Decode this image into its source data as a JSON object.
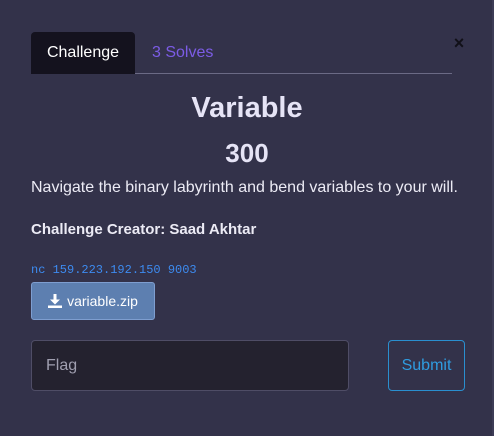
{
  "tabs": {
    "challenge_label": "Challenge",
    "solves_label": "3 Solves"
  },
  "close": {
    "label": "×",
    "icon": "close-icon"
  },
  "challenge": {
    "name": "Variable",
    "points": "300",
    "description": "Navigate the binary labyrinth and bend variables to your will.",
    "creator": "Challenge Creator: Saad Akhtar",
    "connection": "nc 159.223.192.150 9003",
    "file_label": "variable.zip",
    "file_icon": "download-icon"
  },
  "flag_form": {
    "placeholder": "Flag",
    "value": "",
    "submit_label": "Submit"
  },
  "colors": {
    "background": "#33324a",
    "active_tab": "#14121e",
    "solves_link": "#7c5ce6",
    "connection_text": "#3d8bf0",
    "download_button": "#5d7fb0",
    "submit_accent": "#2f9ce0"
  }
}
